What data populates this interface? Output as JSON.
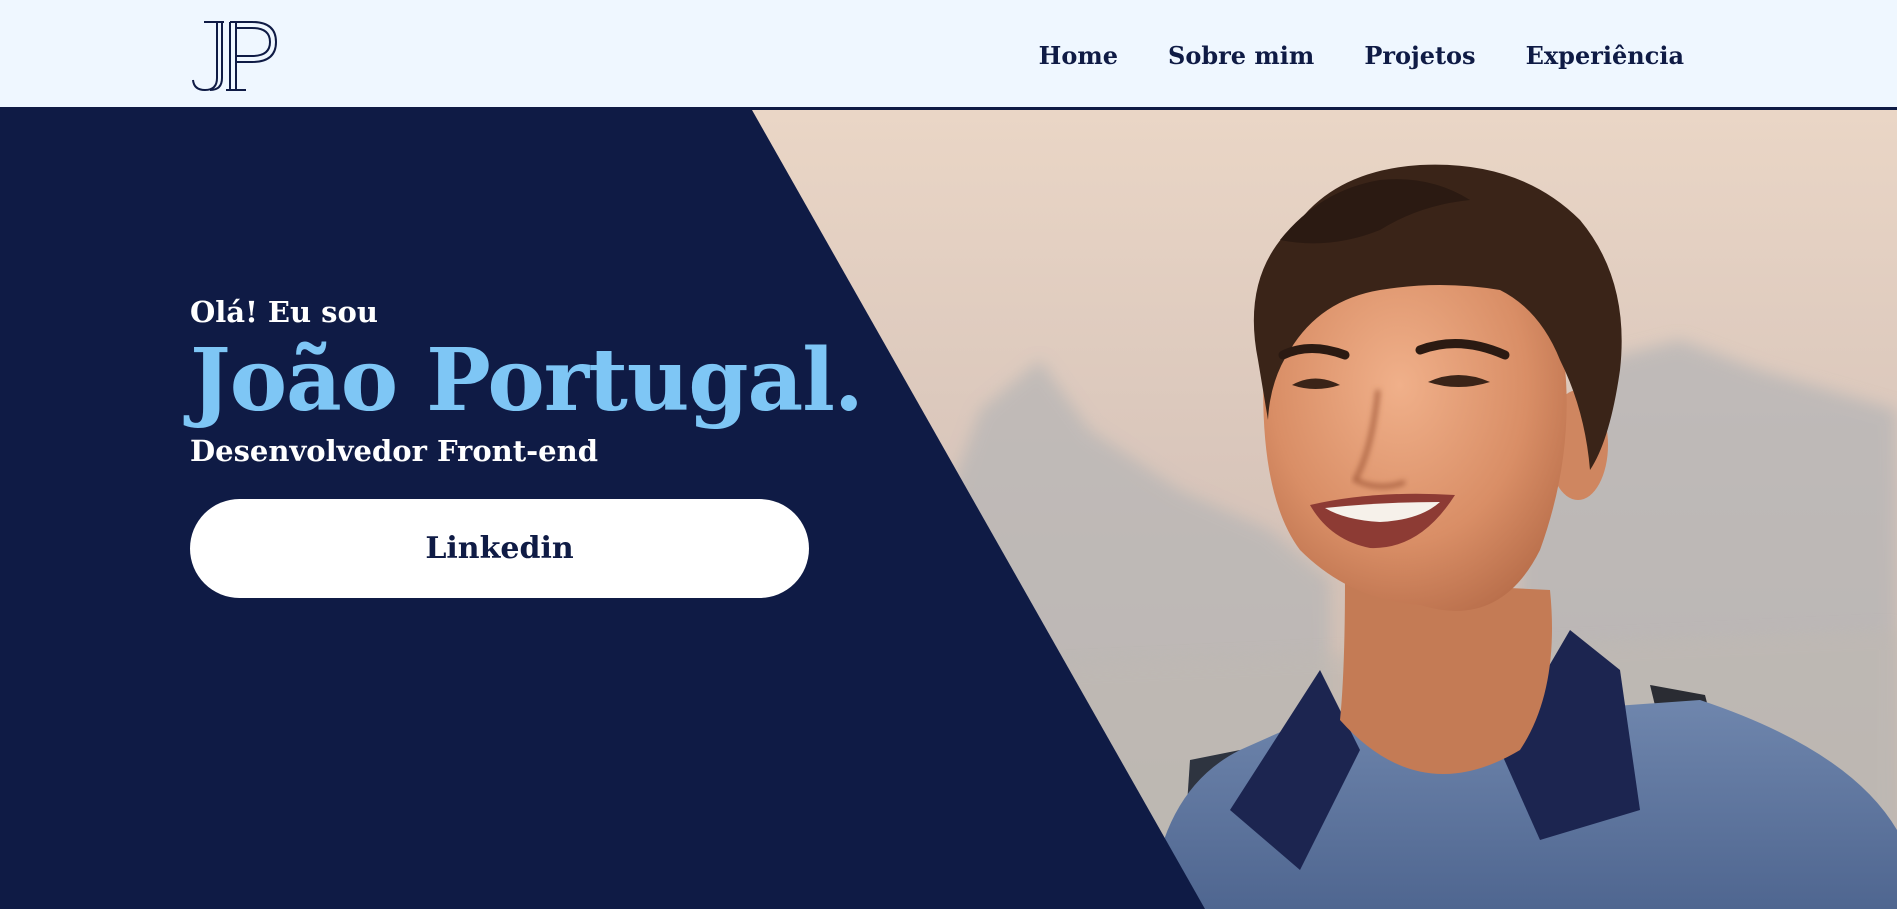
{
  "logo": {
    "text": "JP",
    "icon": "jp-monogram-logo"
  },
  "nav": {
    "items": [
      {
        "label": "Home"
      },
      {
        "label": "Sobre mim"
      },
      {
        "label": "Projetos"
      },
      {
        "label": "Experiência"
      }
    ]
  },
  "hero": {
    "greeting": "Olá! Eu sou",
    "name": "João Portugal.",
    "role": "Desenvolvedor Front-end",
    "cta_label": "Linkedin",
    "photo": "portrait-photo"
  },
  "colors": {
    "navy": "#0f1b45",
    "accent": "#7ec6f5",
    "nav_bg": "#eff7ff",
    "button_bg": "#ffffff"
  }
}
